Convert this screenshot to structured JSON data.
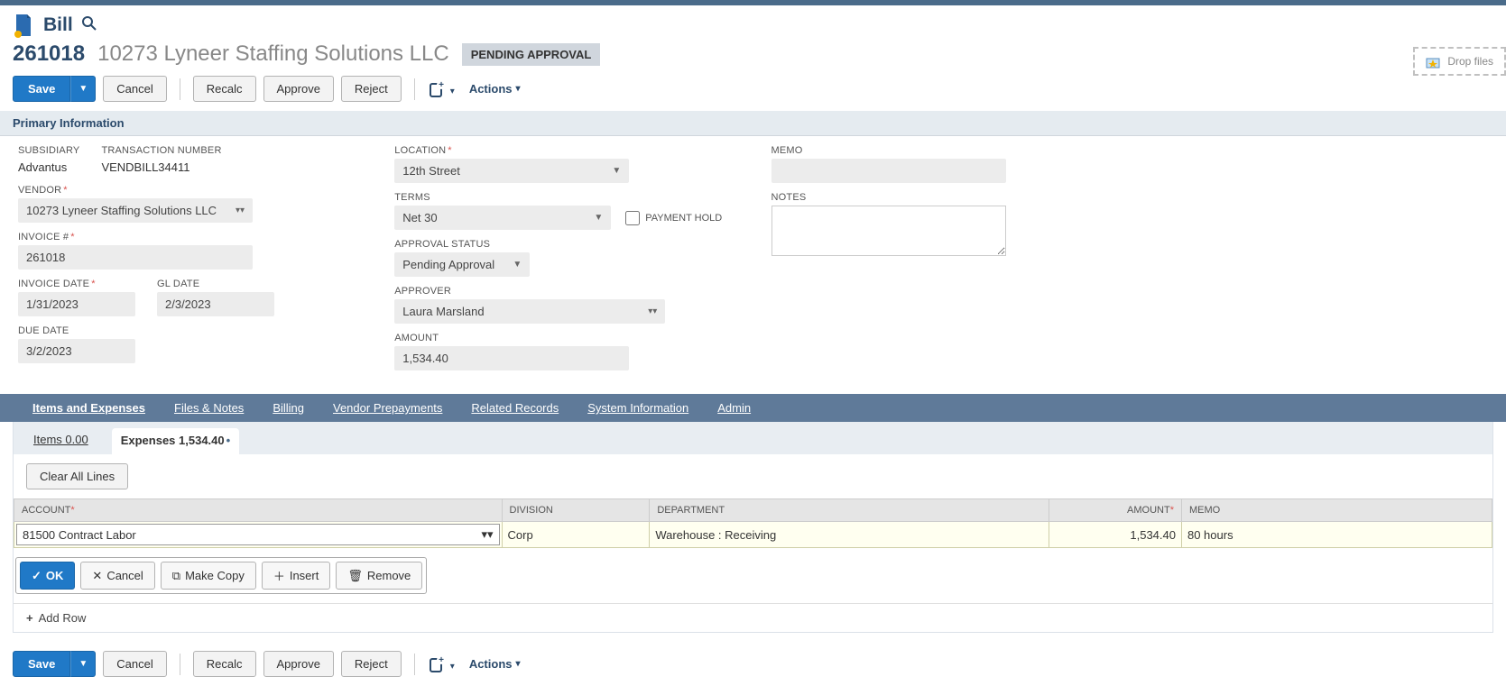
{
  "page": {
    "type": "Bill",
    "record_id": "261018",
    "record_name": "10273 Lyneer Staffing Solutions LLC",
    "status_badge": "PENDING APPROVAL"
  },
  "buttons": {
    "save": "Save",
    "cancel": "Cancel",
    "recalc": "Recalc",
    "approve": "Approve",
    "reject": "Reject",
    "actions": "Actions",
    "drop_files": "Drop files"
  },
  "sections": {
    "primary_info": "Primary Information"
  },
  "fields": {
    "subsidiary": {
      "label": "SUBSIDIARY",
      "value": "Advantus"
    },
    "transaction_number": {
      "label": "TRANSACTION NUMBER",
      "value": "VENDBILL34411"
    },
    "vendor": {
      "label": "VENDOR",
      "value": "10273 Lyneer Staffing Solutions LLC"
    },
    "invoice_no": {
      "label": "INVOICE #",
      "value": "261018"
    },
    "invoice_date": {
      "label": "INVOICE DATE",
      "value": "1/31/2023"
    },
    "gl_date": {
      "label": "GL DATE",
      "value": "2/3/2023"
    },
    "due_date": {
      "label": "DUE DATE",
      "value": "3/2/2023"
    },
    "location": {
      "label": "LOCATION",
      "value": "12th Street"
    },
    "terms": {
      "label": "TERMS",
      "value": "Net 30"
    },
    "payment_hold": {
      "label": "PAYMENT HOLD"
    },
    "approval_status": {
      "label": "APPROVAL STATUS",
      "value": "Pending Approval"
    },
    "approver": {
      "label": "APPROVER",
      "value": "Laura Marsland"
    },
    "amount": {
      "label": "AMOUNT",
      "value": "1,534.40"
    },
    "memo": {
      "label": "MEMO",
      "value": ""
    },
    "notes": {
      "label": "NOTES",
      "value": ""
    }
  },
  "tabs": {
    "items_expenses": "Items and Expenses",
    "files_notes": "Files & Notes",
    "billing": "Billing",
    "vendor_prepayments": "Vendor Prepayments",
    "related_records": "Related Records",
    "system_info": "System Information",
    "admin": "Admin"
  },
  "subtabs": {
    "items": "Items 0.00",
    "expenses": "Expenses 1,534.40"
  },
  "sub_toolbar": {
    "clear_all": "Clear All Lines"
  },
  "table": {
    "headers": {
      "account": "ACCOUNT",
      "division": "DIVISION",
      "department": "DEPARTMENT",
      "amount": "AMOUNT",
      "memo": "MEMO"
    },
    "row": {
      "account": "81500 Contract Labor",
      "division": "Corp",
      "department": "Warehouse : Receiving",
      "amount": "1,534.40",
      "memo": "80 hours"
    }
  },
  "row_buttons": {
    "ok": "OK",
    "cancel": "Cancel",
    "make_copy": "Make Copy",
    "insert": "Insert",
    "remove": "Remove",
    "add_row": "Add Row"
  }
}
